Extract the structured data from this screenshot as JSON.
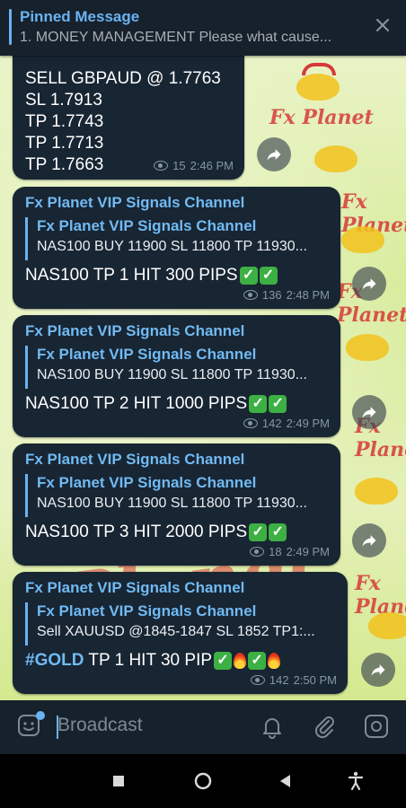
{
  "pinned": {
    "title": "Pinned Message",
    "text": "1. MONEY MANAGEMENT  Please what cause..."
  },
  "messages": [
    {
      "lines": [
        "SELL GBPAUD @ 1.7763",
        "SL 1.7913",
        "TP 1.7743",
        "TP 1.7713",
        "TP 1.7663"
      ],
      "views": "15",
      "time": "2:46 PM"
    },
    {
      "sender": "Fx Planet VIP Signals Channel",
      "quote_name": "Fx Planet VIP Signals Channel",
      "quote_text": "NAS100 BUY 11900 SL 11800 TP 11930...",
      "text": "NAS100 TP 1 HIT 300 PIPS",
      "views": "136",
      "time": "2:48 PM"
    },
    {
      "sender": "Fx Planet VIP Signals Channel",
      "quote_name": "Fx Planet VIP Signals Channel",
      "quote_text": "NAS100 BUY 11900 SL 11800 TP 11930...",
      "text": "NAS100 TP 2 HIT 1000 PIPS",
      "views": "142",
      "time": "2:49 PM"
    },
    {
      "sender": "Fx Planet VIP Signals Channel",
      "quote_name": "Fx Planet VIP Signals Channel",
      "quote_text": "NAS100 BUY 11900 SL 11800 TP 11930...",
      "text": "NAS100 TP 3 HIT 2000 PIPS",
      "views": "18",
      "time": "2:49 PM"
    },
    {
      "sender": "Fx Planet VIP Signals Channel",
      "quote_name": "Fx Planet VIP Signals Channel",
      "quote_text": "Sell XAUUSD @1845-1847  SL 1852  TP1:...",
      "hashtag": "#GOLD",
      "text": " TP 1 HIT 30 PIP",
      "views": "142",
      "time": "2:50 PM"
    }
  ],
  "composer": {
    "placeholder": "Broadcast"
  },
  "wallpaper": {
    "watermark": "Fx Planet"
  },
  "icons": {
    "pin_close": "close-icon",
    "share": "share-icon",
    "sticker": "sticker-icon",
    "bell": "bell-icon",
    "attach": "paperclip-icon",
    "camera": "camera-icon",
    "nav_recents": "square-icon",
    "nav_home": "circle-icon",
    "nav_back": "triangle-back-icon",
    "nav_accessibility": "accessibility-icon"
  },
  "colors": {
    "accent": "#6ab3f3",
    "bubble": "#182533",
    "header": "#17212b",
    "check": "#3cb043"
  }
}
